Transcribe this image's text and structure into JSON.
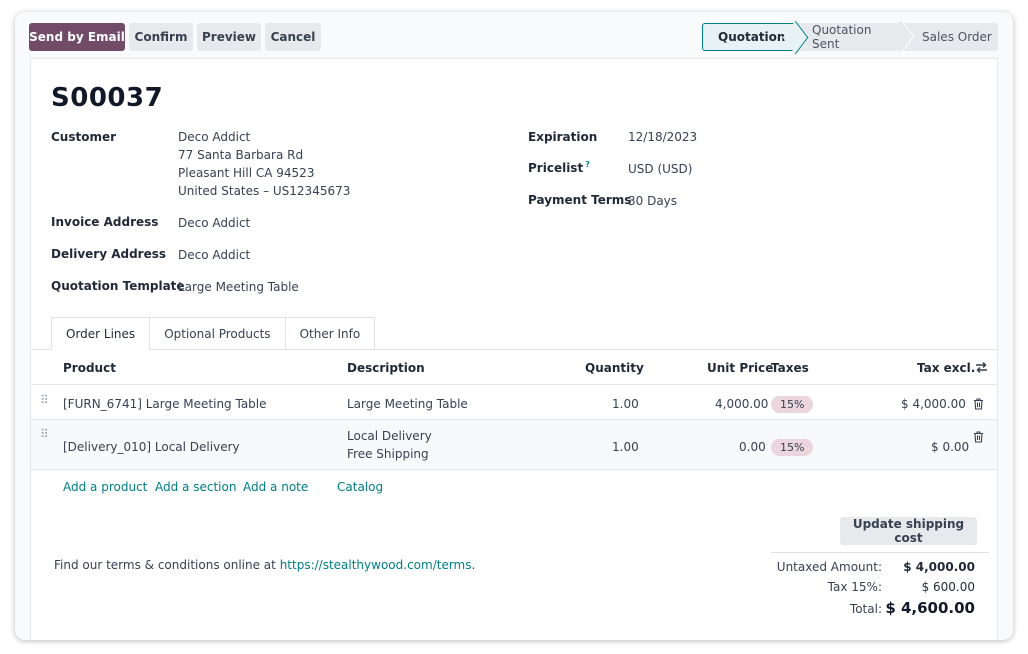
{
  "toolbar": {
    "send_email": "Send by Email",
    "confirm": "Confirm",
    "preview": "Preview",
    "cancel": "Cancel"
  },
  "status": {
    "stages": [
      "Quotation",
      "Quotation Sent",
      "Sales Order"
    ],
    "active": "Quotation"
  },
  "record": {
    "name": "S00037",
    "customer_label": "Customer",
    "customer_name": "Deco Addict",
    "customer_address1": "77 Santa Barbara Rd",
    "customer_address2": "Pleasant Hill CA 94523",
    "customer_address3": "United States – US12345673",
    "invoice_label": "Invoice Address",
    "invoice_value": "Deco Addict",
    "delivery_label": "Delivery Address",
    "delivery_value": "Deco Addict",
    "template_label": "Quotation Template",
    "template_value": "Large Meeting Table",
    "expiration_label": "Expiration",
    "expiration_value": "12/18/2023",
    "pricelist_label": "Pricelist",
    "pricelist_help": "?",
    "pricelist_value": "USD (USD)",
    "payment_label": "Payment Terms",
    "payment_value": "30 Days"
  },
  "tabs": [
    "Order Lines",
    "Optional Products",
    "Other Info"
  ],
  "table": {
    "headers": {
      "product": "Product",
      "description": "Description",
      "quantity": "Quantity",
      "unit_price": "Unit Price",
      "taxes": "Taxes",
      "tax_excl": "Tax excl."
    },
    "rows": [
      {
        "product": "[FURN_6741] Large Meeting Table",
        "description": "Large Meeting Table",
        "description2": "",
        "quantity": "1.00",
        "unit_price": "4,000.00",
        "tax": "15%",
        "subtotal": "$ 4,000.00"
      },
      {
        "product": "[Delivery_010] Local Delivery",
        "description": "Local Delivery",
        "description2": "Free Shipping",
        "quantity": "1.00",
        "unit_price": "0.00",
        "tax": "15%",
        "subtotal": "$ 0.00"
      }
    ]
  },
  "actions": {
    "add_product": "Add a product",
    "add_section": "Add a section",
    "add_note": "Add a note",
    "catalog": "Catalog"
  },
  "shipping_button": "Update shipping cost",
  "terms": {
    "text": "Find our terms & conditions online at ",
    "url": "https://stealthywood.com/terms",
    "suffix": "."
  },
  "totals": {
    "untaxed_label": "Untaxed Amount:",
    "untaxed_value": "$ 4,000.00",
    "tax_label": "Tax 15%:",
    "tax_value": "$ 600.00",
    "total_label": "Total:",
    "total_value": "$ 4,600.00"
  },
  "colors": {
    "primary": "#714b67",
    "link": "#017e84",
    "badge": "#ead6dc"
  },
  "icons": {
    "drag": "drag-handle-icon",
    "trash": "trash-icon",
    "columns": "column-toggle-icon"
  }
}
